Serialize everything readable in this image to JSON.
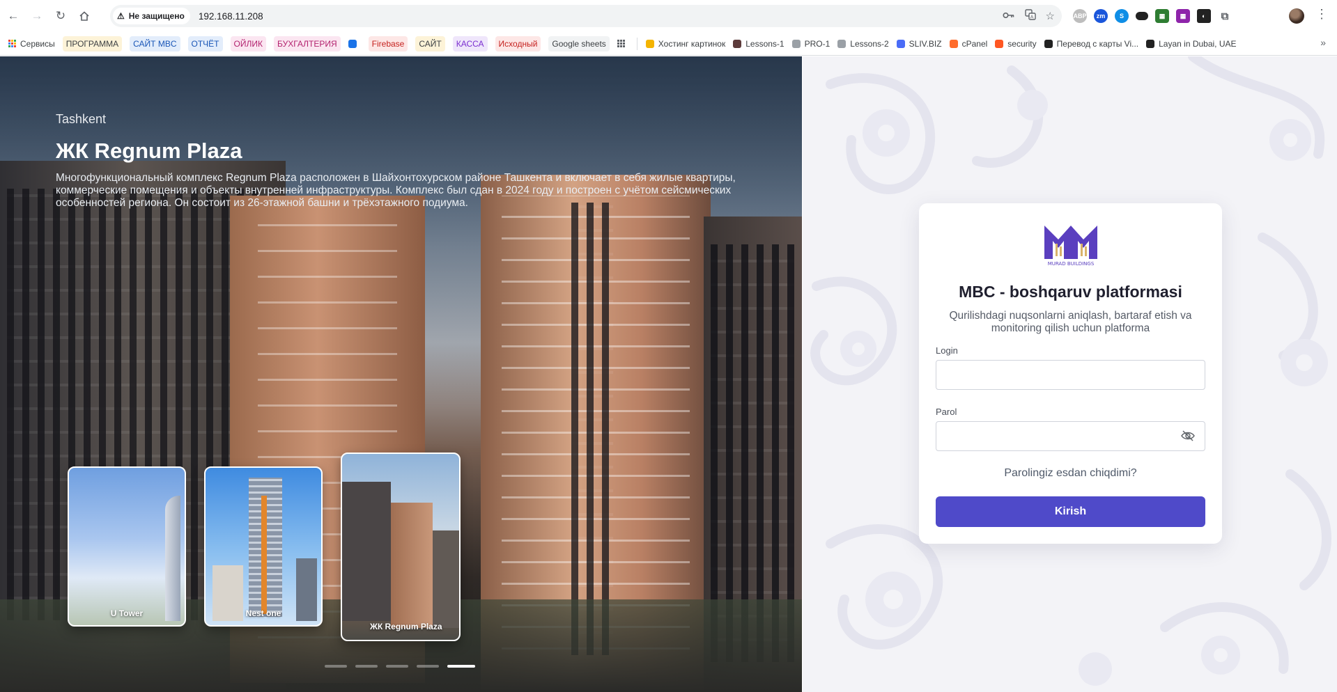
{
  "browser": {
    "security_label": "Не защищено",
    "url": "192.168.11.208",
    "bookmarks": [
      {
        "label": "Сервисы",
        "chip": false,
        "bg": "",
        "color": "#3c4043"
      },
      {
        "label": "ПРОГРАММА",
        "chip": true,
        "bg": "#fdf3d8",
        "color": "#3c4043"
      },
      {
        "label": "САЙТ MBC",
        "chip": true,
        "bg": "#e3edfb",
        "color": "#1a56b7"
      },
      {
        "label": "ОТЧЁТ",
        "chip": true,
        "bg": "#e3edfb",
        "color": "#1a56b7"
      },
      {
        "label": "ОЙЛИК",
        "chip": true,
        "bg": "#fbe6f1",
        "color": "#b3226f"
      },
      {
        "label": "БУХГАЛТЕРИЯ",
        "chip": true,
        "bg": "#fbe6f1",
        "color": "#b3226f"
      },
      {
        "label": "",
        "chip": false,
        "bg": "#1a73e8",
        "color": "#3c4043"
      },
      {
        "label": "Firebase",
        "chip": true,
        "bg": "#fde7e6",
        "color": "#c5221f"
      },
      {
        "label": "САЙТ",
        "chip": true,
        "bg": "#fdf3d8",
        "color": "#3c4043"
      },
      {
        "label": "КАССА",
        "chip": true,
        "bg": "#efe6fb",
        "color": "#7b2fd0"
      },
      {
        "label": "Исходный",
        "chip": true,
        "bg": "#fde7e6",
        "color": "#c5221f"
      },
      {
        "label": "Google sheets",
        "chip": true,
        "bg": "#f1f3f4",
        "color": "#3c4043"
      },
      {
        "label": "",
        "chip": false,
        "bg": "grid",
        "color": "#3c4043"
      },
      {
        "label": "Хостинг картинок",
        "chip": false,
        "bg": "#f4b400",
        "color": "#3c4043"
      },
      {
        "label": "Lessons-1",
        "chip": false,
        "bg": "#5c3b3b",
        "color": "#3c4043"
      },
      {
        "label": "PRO-1",
        "chip": false,
        "bg": "#9aa0a6",
        "color": "#3c4043"
      },
      {
        "label": "Lessons-2",
        "chip": false,
        "bg": "#9aa0a6",
        "color": "#3c4043"
      },
      {
        "label": "SLIV.BIZ",
        "chip": false,
        "bg": "#4a6cf7",
        "color": "#3c4043"
      },
      {
        "label": "cPanel",
        "chip": false,
        "bg": "#ff6c2c",
        "color": "#3c4043"
      },
      {
        "label": "security",
        "chip": false,
        "bg": "#ff5722",
        "color": "#3c4043"
      },
      {
        "label": "Перевод с карты Vi...",
        "chip": false,
        "bg": "#222222",
        "color": "#3c4043"
      },
      {
        "label": "Layan in Dubai, UAE",
        "chip": false,
        "bg": "#222222",
        "color": "#3c4043"
      }
    ]
  },
  "hero": {
    "city": "Tashkent",
    "title": "ЖК Regnum Plaza",
    "description": "Многофункциональный комплекс Regnum Plaza расположен в Шайхонтохурском районе Ташкента и включает в себя жилые квартиры, коммерческие помещения и объекты внутренней инфраструктуры. Комплекс был сдан в 2024 году и построен с учётом сейсмических особенностей региона. Он состоит из 26-этажной башни и трёхэтажного подиума.",
    "thumbnails": [
      "U Tower",
      "Nest one",
      "ЖК Regnum Plaza"
    ],
    "slides_total": 5,
    "slide_active": 5
  },
  "login": {
    "title": "MBC - boshqaruv platformasi",
    "subtitle": "Qurilishdagi nuqsonlarni aniqlash, bartaraf etish va monitoring qilish uchun platforma",
    "login_label": "Login",
    "login_value": "",
    "password_label": "Parol",
    "password_value": "",
    "forgot_label": "Parolingiz esdan chiqdimi?",
    "submit_label": "Kirish",
    "logo_text": "MURAD BUILDINGS"
  },
  "colors": {
    "accent": "#4f4ac9",
    "logo": "#5a3fbf"
  }
}
